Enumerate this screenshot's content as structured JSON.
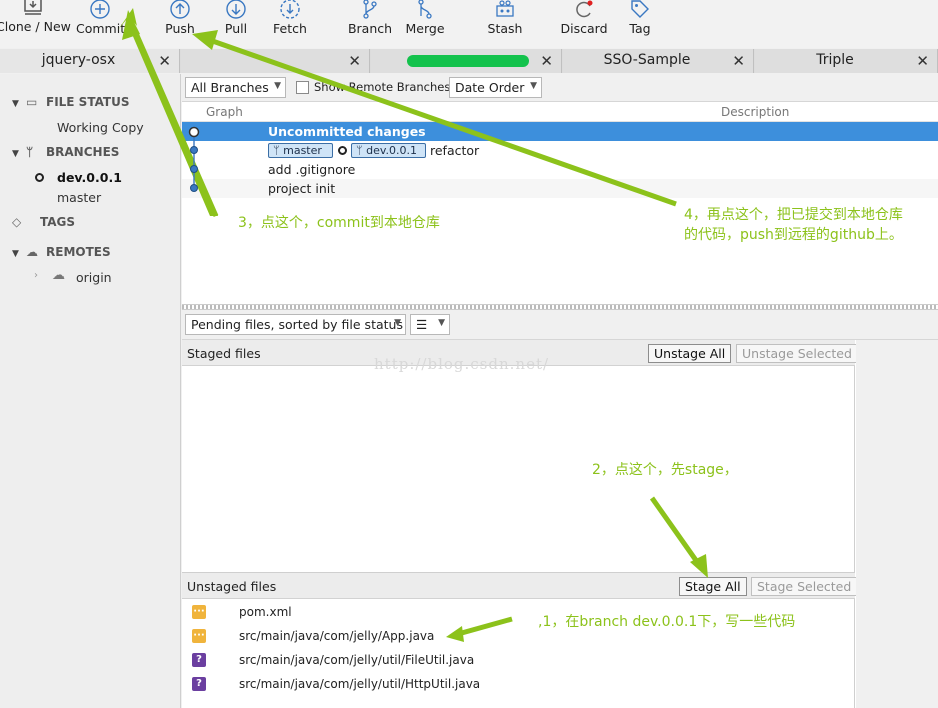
{
  "toolbar": {
    "items": [
      {
        "label": "Clone / New",
        "icon": "monitor-download-icon"
      },
      {
        "label": "Commit",
        "icon": "plus-circle-icon"
      },
      {
        "label": "Push",
        "icon": "arrow-up-circle-icon"
      },
      {
        "label": "Pull",
        "icon": "arrow-down-circle-icon"
      },
      {
        "label": "Fetch",
        "icon": "dashed-arrow-down-icon"
      },
      {
        "label": "Branch",
        "icon": "branch-icon"
      },
      {
        "label": "Merge",
        "icon": "merge-icon"
      },
      {
        "label": "Stash",
        "icon": "stash-icon"
      },
      {
        "label": "Discard",
        "icon": "discard-icon"
      },
      {
        "label": "Tag",
        "icon": "tag-icon"
      }
    ]
  },
  "tabs": [
    {
      "label": "jquery-osx"
    },
    {
      "label": ""
    },
    {
      "label": ""
    },
    {
      "label": "SSO-Sample"
    },
    {
      "label": "Triple"
    }
  ],
  "sidebar": {
    "file_status": {
      "title": "FILE STATUS",
      "items": [
        "Working Copy"
      ]
    },
    "branches": {
      "title": "BRANCHES",
      "items": [
        "dev.0.0.1",
        "master"
      ]
    },
    "tags": {
      "title": "TAGS"
    },
    "remotes": {
      "title": "REMOTES",
      "items": [
        "origin"
      ]
    }
  },
  "filter": {
    "branches": "All Branches",
    "show_remote": "Show Remote Branches",
    "order": "Date Order"
  },
  "columns": {
    "graph": "Graph",
    "description": "Description"
  },
  "commits": [
    {
      "desc": "Uncommitted changes"
    },
    {
      "refs": [
        "master",
        "dev.0.0.1"
      ],
      "desc": "refactor"
    },
    {
      "desc": "add .gitignore"
    },
    {
      "desc": "project init"
    }
  ],
  "pending": {
    "sort": "Pending files, sorted by file status"
  },
  "staged": {
    "title": "Staged files",
    "unstage_all": "Unstage All",
    "unstage_selected": "Unstage Selected"
  },
  "unstaged": {
    "title": "Unstaged files",
    "stage_all": "Stage All",
    "stage_selected": "Stage Selected",
    "files": [
      {
        "status": "modified",
        "path": "pom.xml"
      },
      {
        "status": "modified",
        "path": "src/main/java/com/jelly/App.java"
      },
      {
        "status": "untracked",
        "path": "src/main/java/com/jelly/util/FileUtil.java"
      },
      {
        "status": "untracked",
        "path": "src/main/java/com/jelly/util/HttpUtil.java"
      }
    ]
  },
  "watermark": "http://blog.csdn.net/",
  "annotations": {
    "step1": ",1，在branch dev.0.0.1下，写一些代码",
    "step2": "2，点这个，先stage，",
    "step3": "3，点这个，commit到本地仓库",
    "step4_line1": "4，再点这个，把已提交到本地仓库",
    "step4_line2": "的代码，push到远程的github上。"
  },
  "colors": {
    "accent": "#3d8fdc",
    "annotation": "#8cc21b"
  }
}
